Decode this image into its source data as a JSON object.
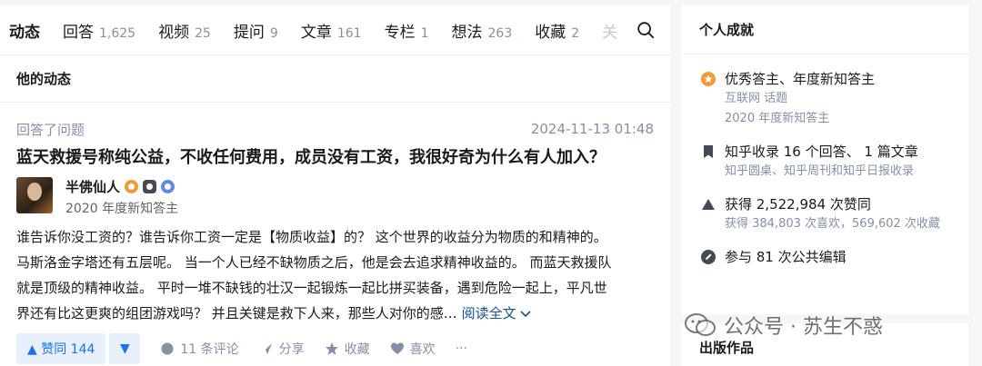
{
  "tabs": [
    {
      "label": "动态",
      "count": ""
    },
    {
      "label": "回答",
      "count": "1,625"
    },
    {
      "label": "视频",
      "count": "25"
    },
    {
      "label": "提问",
      "count": "9"
    },
    {
      "label": "文章",
      "count": "161"
    },
    {
      "label": "专栏",
      "count": "1"
    },
    {
      "label": "想法",
      "count": "263"
    },
    {
      "label": "收藏",
      "count": "2"
    },
    {
      "label": "关",
      "count": ""
    }
  ],
  "section_title": "他的动态",
  "feed": {
    "action": "回答了问题",
    "time": "2024-11-13 01:48",
    "question": "蓝天救援号称纯公益，不收任何费用，成员没有工资，我很好奇为什么有人加入？",
    "author_name": "半佛仙人",
    "author_tag": "2020 年度新知答主",
    "excerpt_lines": [
      "谁告诉你没工资的？谁告诉你工资一定是【物质收益】的？ 这个世界的收益分为物质的和精神的。",
      "马斯洛金字塔还有五层呢。 当一个人已经不缺物质之后，他是会去追求精神收益的。 而蓝天救援队",
      "就是顶级的精神收益。 平时一堆不缺钱的壮汉一起锻炼一起比拼买装备，遇到危险一起上，平凡世",
      "界还有比这更爽的组团游戏吗？ 并且关键是救下人来，那些人对你的感…"
    ],
    "read_more": "阅读全文",
    "vote_label": "▲ 赞同 144",
    "vote_down": "▼",
    "comments": "11 条评论",
    "share": "分享",
    "collect": "收藏",
    "like": "喜欢",
    "more": "···"
  },
  "side": {
    "title": "个人成就",
    "achievements": [
      {
        "icon": "excellent-answerer-icon",
        "main": "优秀答主、年度新知答主",
        "subs": [
          "互联网 话题",
          "2020 年度新知答主"
        ]
      },
      {
        "icon": "bookmark-icon",
        "main": "知乎收录 16 个回答、 1 篇文章",
        "subs": [
          "知乎圆桌、知乎周刊和知乎日报收录"
        ]
      },
      {
        "icon": "upvote-icon",
        "main": "获得 2,522,984 次赞同",
        "subs": [
          "获得 384,803 次喜欢，569,602 次收藏"
        ]
      },
      {
        "icon": "edit-icon",
        "main": "参与 81 次公共编辑",
        "subs": []
      }
    ],
    "publications_title": "出版作品"
  },
  "watermark": "公众号 · 苏生不惑",
  "colors": {
    "accent": "#1772f6",
    "muted": "#8590a6",
    "link": "#175199",
    "badge_orange": "#f29a38"
  }
}
